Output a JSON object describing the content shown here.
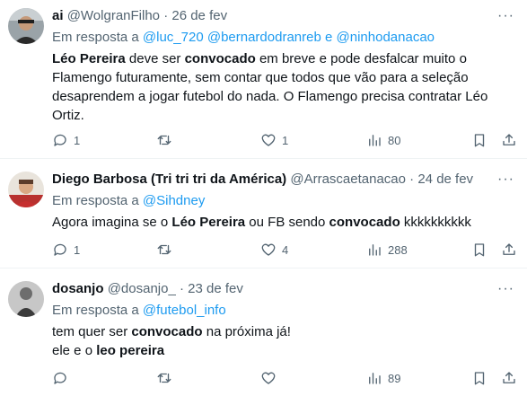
{
  "tweets": [
    {
      "name": "ai",
      "handle": "@WolgranFilho",
      "date": "26 de fev",
      "reply_prefix": "Em resposta a",
      "reply_to": [
        "@luc_720",
        "@bernardodranreb",
        "@ninhodanacao"
      ],
      "reply_joiner": "e",
      "body": [
        {
          "t": "Léo Pereira",
          "b": true
        },
        {
          "t": " deve ser ",
          "b": false
        },
        {
          "t": "convocado",
          "b": true
        },
        {
          "t": " em breve e pode desfalcar muito o Flamengo futuramente, sem contar que todos que vão para a seleção desaprendem a jogar futebol do nada. O Flamengo precisa contratar Léo Ortiz.",
          "b": false
        }
      ],
      "replies": "1",
      "retweets": "",
      "likes": "1",
      "views": "80"
    },
    {
      "name": "Diego Barbosa (Tri tri tri da América)",
      "handle": "@Arrascaetanacao",
      "date": "24 de fev",
      "reply_prefix": "Em resposta a",
      "reply_to": [
        "@Sihdney"
      ],
      "reply_joiner": "",
      "body": [
        {
          "t": "Agora imagina se o ",
          "b": false
        },
        {
          "t": "Léo Pereira",
          "b": true
        },
        {
          "t": " ou FB sendo ",
          "b": false
        },
        {
          "t": "convocado",
          "b": true
        },
        {
          "t": " kkkkkkkkkk",
          "b": false
        }
      ],
      "replies": "1",
      "retweets": "",
      "likes": "4",
      "views": "288"
    },
    {
      "name": "dosanjo",
      "handle": "@dosanjo_",
      "date": "23 de fev",
      "reply_prefix": "Em resposta a",
      "reply_to": [
        "@futebol_info"
      ],
      "reply_joiner": "",
      "body": [
        {
          "t": "tem quer ser ",
          "b": false
        },
        {
          "t": "convocado",
          "b": true
        },
        {
          "t": " na próxima já!",
          "b": false
        },
        {
          "t": "\n",
          "b": false
        },
        {
          "t": "ele e o ",
          "b": false
        },
        {
          "t": "leo pereira",
          "b": true
        }
      ],
      "replies": "",
      "retweets": "",
      "likes": "",
      "views": "89"
    }
  ],
  "separator": "·",
  "more_glyph": "···",
  "icons": [
    "reply-icon",
    "retweet-icon",
    "like-icon",
    "views-icon",
    "bookmark-icon",
    "share-icon"
  ],
  "colors": {
    "link": "#1d9bf0",
    "muted": "#536471",
    "text": "#0f1419",
    "divider": "#eff3f4"
  }
}
